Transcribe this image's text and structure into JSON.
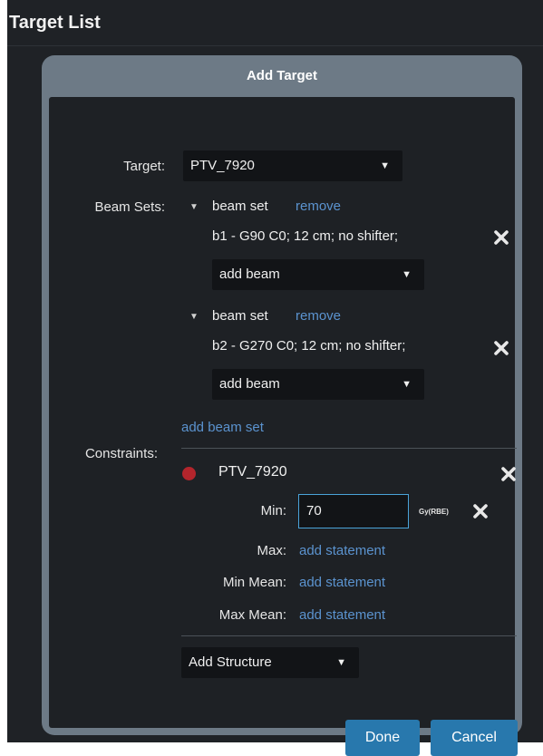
{
  "panel": {
    "title": "Target List"
  },
  "dialog": {
    "title": "Add Target",
    "target_label": "Target:",
    "target_value": "PTV_7920",
    "beam_sets_label": "Beam Sets:",
    "beam_sets": [
      {
        "name": "beam set",
        "remove_link": "remove",
        "beams": [
          "b1 - G90 C0; 12 cm; no shifter;"
        ],
        "add_beam": "add beam"
      },
      {
        "name": "beam set",
        "remove_link": "remove",
        "beams": [
          "b2 - G270 C0; 12 cm; no shifter;"
        ],
        "add_beam": "add beam"
      }
    ],
    "add_beam_set_link": "add beam set",
    "constraints_label": "Constraints:",
    "constraint": {
      "structure": "PTV_7920",
      "structure_color": "#b3252c",
      "min_label": "Min:",
      "min_value": "70",
      "min_unit": "Gy(RBE)",
      "max_label": "Max:",
      "max_link": "add statement",
      "min_mean_label": "Min Mean:",
      "min_mean_link": "add statement",
      "max_mean_label": "Max Mean:",
      "max_mean_link": "add statement"
    },
    "add_structure": "Add Structure",
    "done_button": "Done",
    "cancel_button": "Cancel"
  },
  "colors": {
    "accent": "#2878ad",
    "link": "#5b93cf",
    "focus": "#4aa3d9"
  },
  "icons": {
    "dropdown": "triangle-down-icon",
    "remove": "close-icon",
    "expand": "triangle-down-icon"
  }
}
